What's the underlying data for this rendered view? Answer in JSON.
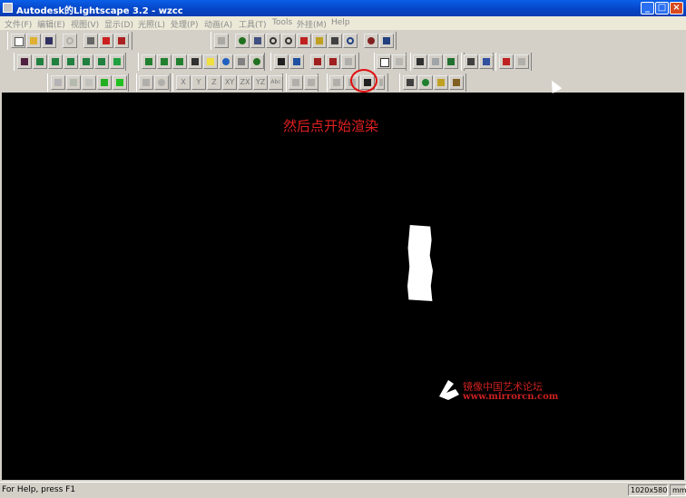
{
  "window": {
    "title": "Autodesk的Lightscape 3.2 - wzcc",
    "buttons": {
      "minimize": "_",
      "maximize": "□",
      "close": "×"
    }
  },
  "menu": {
    "items": [
      "文件(F)",
      "编辑(E)",
      "视图(V)",
      "显示(D)",
      "光照(L)",
      "处理(P)",
      "动画(A)",
      "工具(T)",
      "Tools",
      "外挂(M)",
      "Help"
    ]
  },
  "toolbar": {
    "axis_labels": [
      "X",
      "Y",
      "Z",
      "XY",
      "ZX",
      "YZ",
      "Abc"
    ]
  },
  "viewport": {
    "annotation": "然后点开始渲染",
    "watermark_cn": "镜像中国艺术论坛",
    "watermark_url": "www.mirrorcn.com"
  },
  "statusbar": {
    "help": "For Help, press F1",
    "resolution": "1020x580",
    "units": "mm"
  },
  "colors": {
    "titlebar": "#0646c8",
    "annotation": "#e02020",
    "viewport": "#000000"
  }
}
